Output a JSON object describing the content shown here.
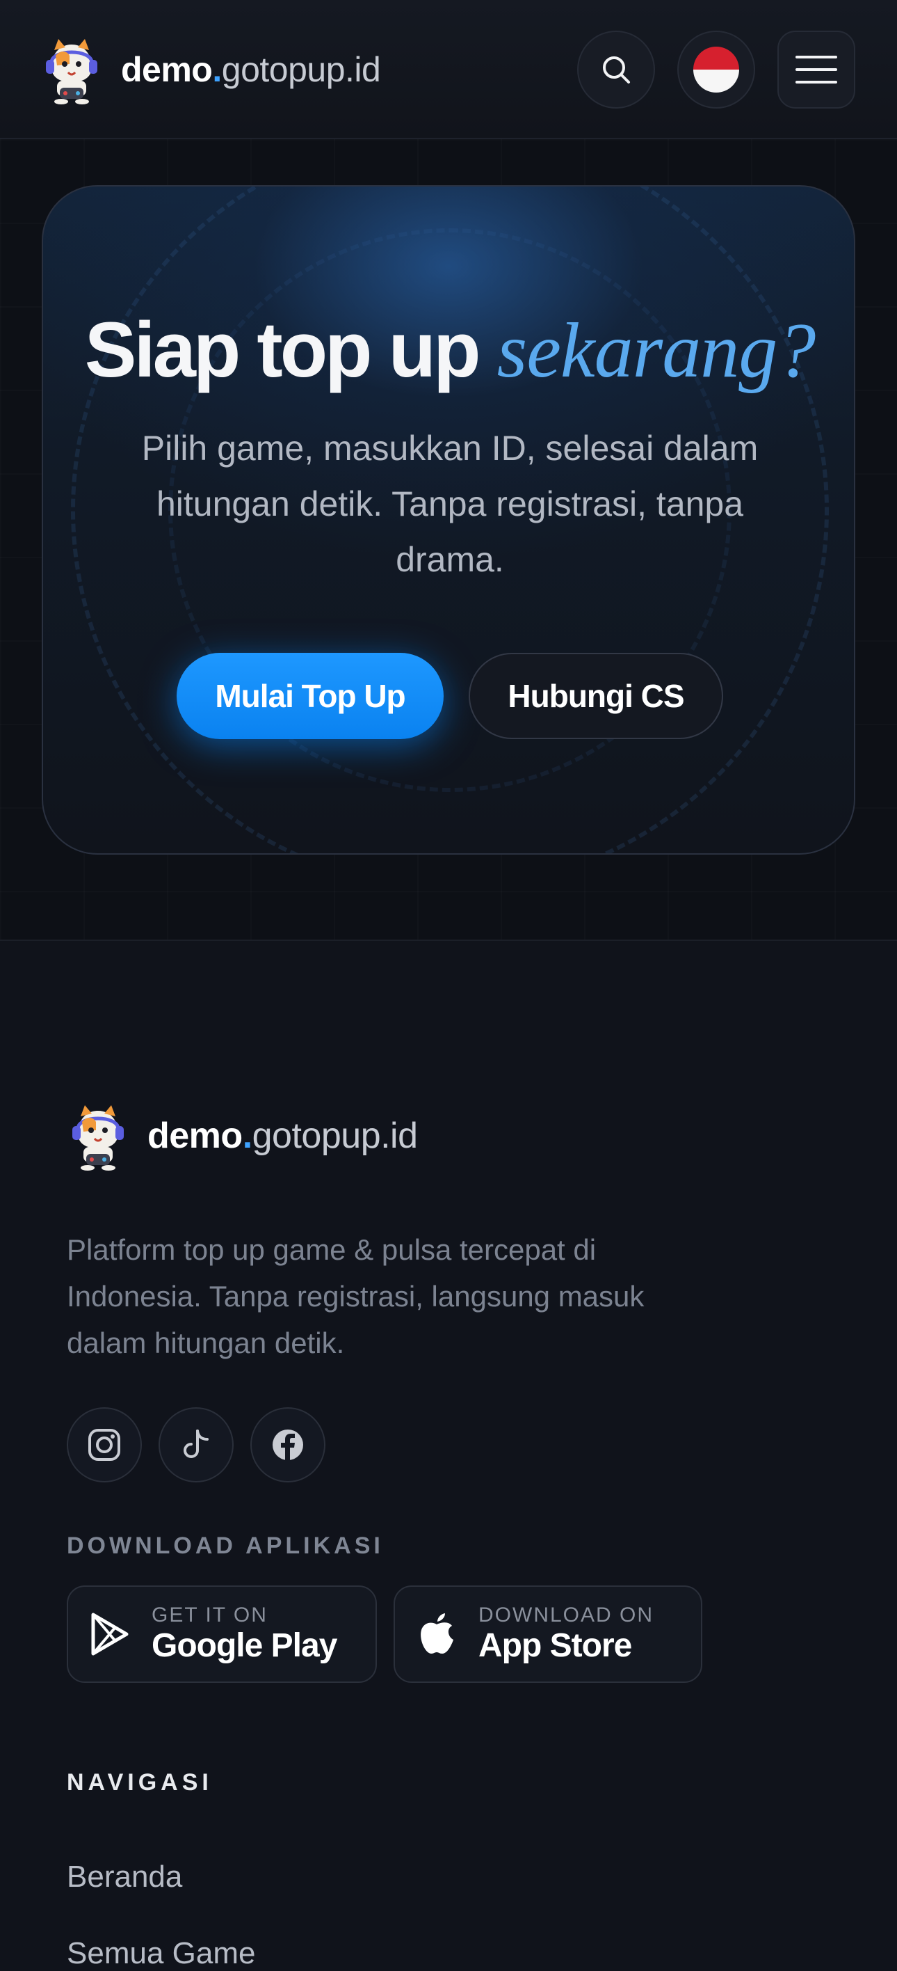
{
  "header": {
    "brand_part1": "demo",
    "brand_dot": ".",
    "brand_part2": "gotopup.id",
    "search_icon": "search-icon",
    "flag_icon": "indonesia-flag-icon",
    "menu_icon": "hamburger-menu-icon"
  },
  "hero": {
    "title_main": "Siap top up",
    "title_accent": "sekarang?",
    "subtitle": "Pilih game, masukkan ID, selesai dalam hitungan detik. Tanpa registrasi, tanpa drama.",
    "primary_button": "Mulai Top Up",
    "secondary_button": "Hubungi CS"
  },
  "footer": {
    "brand_part1": "demo",
    "brand_dot": ".",
    "brand_part2": "gotopup.id",
    "description": "Platform top up game & pulsa tercepat di Indonesia. Tanpa registrasi, langsung masuk dalam hitungan detik.",
    "socials": [
      "instagram-icon",
      "tiktok-icon",
      "facebook-icon"
    ],
    "download_heading": "DOWNLOAD APLIKASI",
    "google_play": {
      "small": "GET IT ON",
      "big": "Google Play"
    },
    "app_store": {
      "small": "DOWNLOAD ON",
      "big": "App Store"
    },
    "nav_heading": "NAVIGASI",
    "nav_links": [
      "Beranda",
      "Semua Game"
    ]
  },
  "colors": {
    "accent": "#0a82f0",
    "accent_text": "#5aa9ee",
    "background": "#10131b"
  }
}
